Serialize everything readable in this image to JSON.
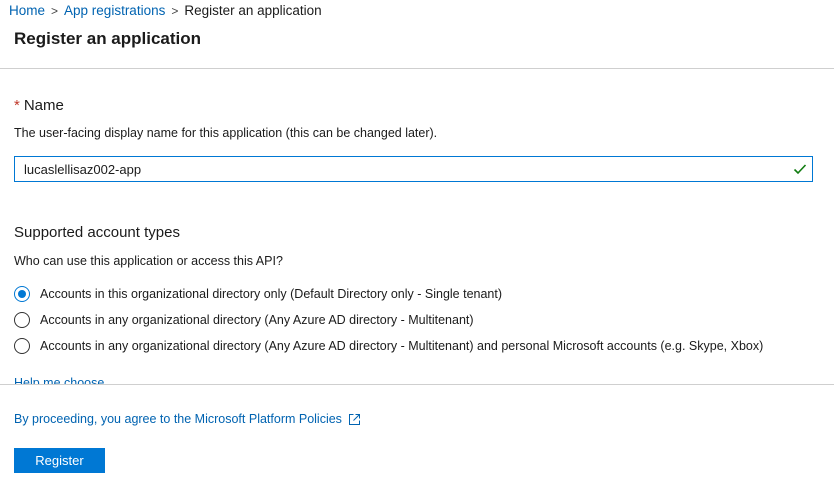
{
  "breadcrumb": {
    "items": [
      "Home",
      "App registrations",
      "Register an application"
    ],
    "separator": ">"
  },
  "page": {
    "title": "Register an application"
  },
  "name_section": {
    "required_marker": "*",
    "label": "Name",
    "description": "The user-facing display name for this application (this can be changed later).",
    "input_value": "lucaslellisaz002-app",
    "validation_icon": "checkmark-icon"
  },
  "account_types": {
    "heading": "Supported account types",
    "question": "Who can use this application or access this API?",
    "options": [
      {
        "label": "Accounts in this organizational directory only (Default Directory only - Single tenant)",
        "selected": true
      },
      {
        "label": "Accounts in any organizational directory (Any Azure AD directory - Multitenant)",
        "selected": false
      },
      {
        "label": "Accounts in any organizational directory (Any Azure AD directory - Multitenant) and personal Microsoft accounts (e.g. Skype, Xbox)",
        "selected": false
      }
    ],
    "help_link": "Help me choose..."
  },
  "footer": {
    "policies_text": "By proceeding, you agree to the Microsoft Platform Policies",
    "policies_icon": "external-link-icon",
    "register_label": "Register"
  },
  "colors": {
    "accent": "#0078d4",
    "link": "#0063b1",
    "required": "#c0392b",
    "valid": "#107c10"
  }
}
